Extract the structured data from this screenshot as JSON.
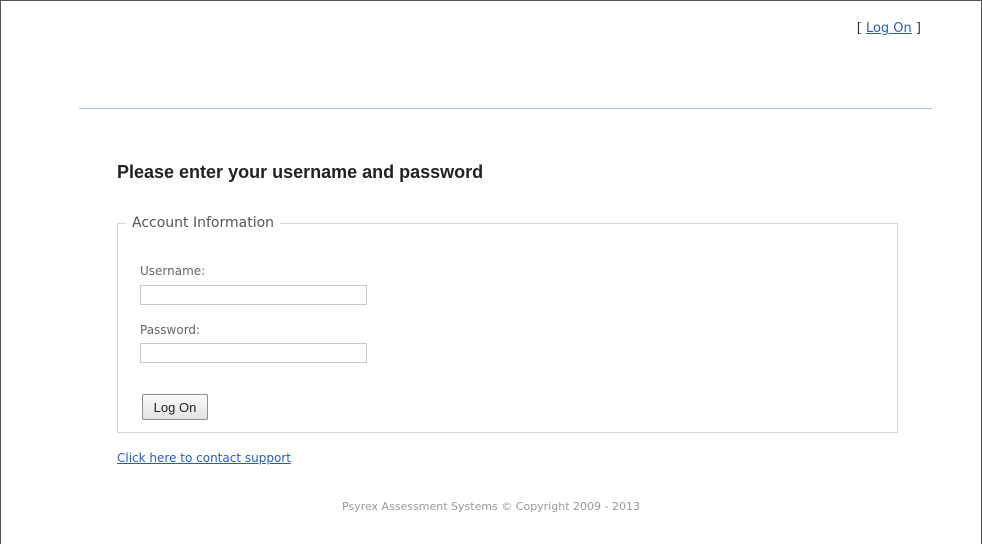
{
  "header": {
    "login_prefix": "[ ",
    "login_link": "Log On",
    "login_suffix": " ]"
  },
  "main": {
    "title": "Please enter your username and password",
    "fieldset_legend": "Account Information",
    "username_label": "Username:",
    "username_value": "",
    "password_label": "Password:",
    "password_value": "",
    "submit_label": "Log On",
    "support_link": "Click here to contact support"
  },
  "footer": {
    "text": "Psyrex Assessment Systems © Copyright 2009 - 2013"
  },
  "colors": {
    "link": "#2a5db0",
    "header_rule": "#a9c3de",
    "footer_text": "#999999"
  }
}
